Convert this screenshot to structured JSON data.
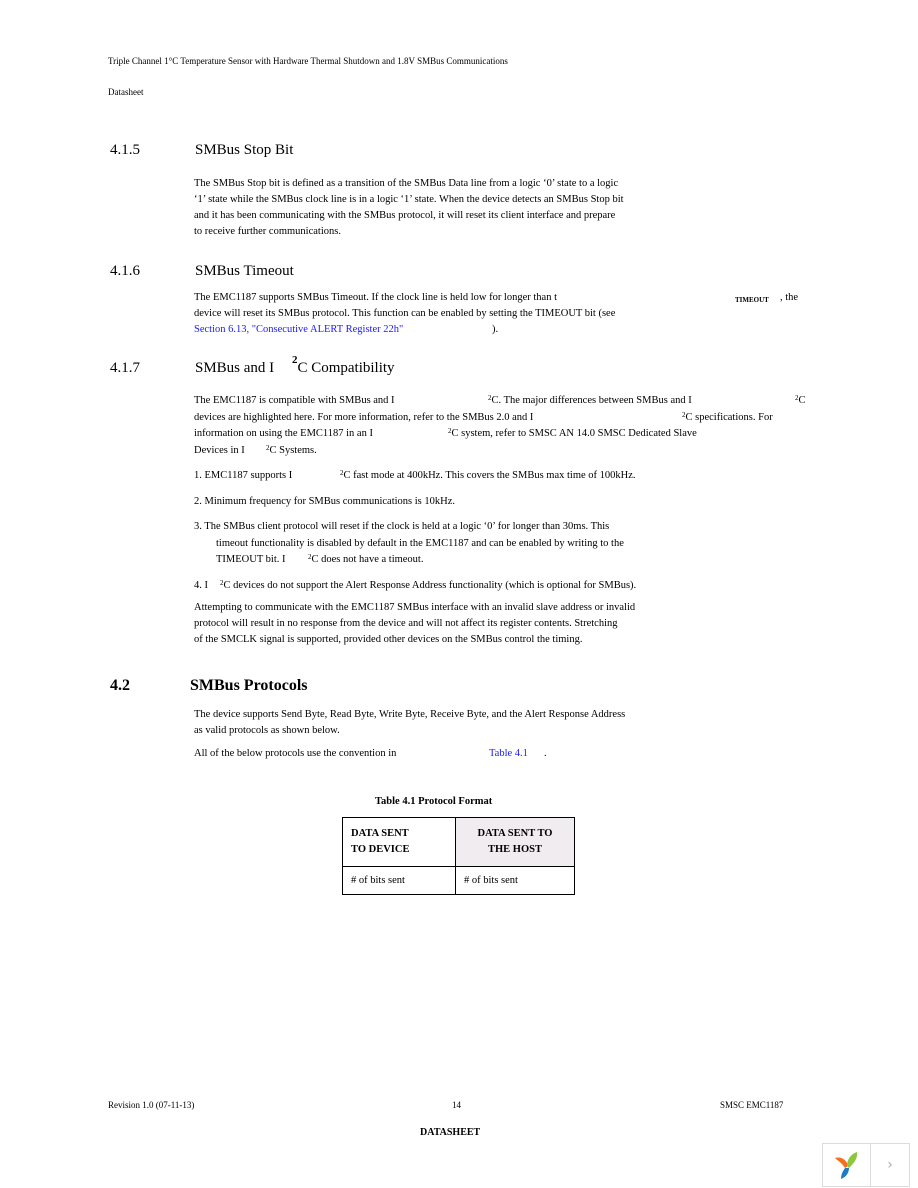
{
  "header": {
    "title": "Triple Channel 1°C Temperature Sensor with Hardware Thermal Shutdown and 1.8V SMBus Communications",
    "subtitle": "Datasheet"
  },
  "s415": {
    "num": "4.1.5",
    "title": "SMBus Stop Bit",
    "lines": [
      "The SMBus Stop bit is defined as a transition of the SMBus Data line from a logic ‘0’ state to a logic",
      "‘1’ state while the SMBus clock line is in a logic ‘1’ state. When the device detects an SMBus Stop bit",
      "and it has been communicating with the SMBus protocol, it will reset its client interface and prepare",
      "to receive further communications."
    ]
  },
  "s416": {
    "num": "4.1.6",
    "title": "SMBus Timeout",
    "line1": "The EMC1187 supports SMBus Timeout. If the clock line is held low for longer than t",
    "line1_sub": "TIMEOUT",
    "line1_end": ", the",
    "line2": "device will reset its SMBus protocol. This function can be enabled by setting the TIMEOUT bit (see",
    "link": "Section 6.13, \"Consecutive ALERT Register 22h\"",
    "line3_end": ")."
  },
  "s417": {
    "num": "4.1.7",
    "title_a": "SMBus and I",
    "title_sup": "2",
    "title_b": "C Compatibility",
    "p1": {
      "l1a": "The EMC1187 is compatible with SMBus and I",
      "l1b": "C. The major differences between SMBus and I",
      "l1c": "C",
      "l2a": "devices are highlighted here. For more information, refer to the SMBus 2.0 and I",
      "l2b": "C specifications. For",
      "l3a": "information on using the EMC1187 in an I",
      "l3b": "C system, refer to SMSC AN 14.0 SMSC Dedicated Slave",
      "l4a": "Devices in I",
      "l4b": "C Systems."
    },
    "sup": "2",
    "items": {
      "i1a": "1. EMC1187 supports I",
      "i1b": "C fast mode at 400kHz. This covers the SMBus max time of 100kHz.",
      "i2": "2. Minimum frequency for SMBus communications is 10kHz.",
      "i3a": "3. The SMBus client protocol will reset if the clock is held at a logic ‘0’ for longer than 30ms. This",
      "i3b": "timeout functionality is disabled by default in the EMC1187 and can be enabled by writing to the",
      "i3c": "TIMEOUT bit. I",
      "i3d": "C does not have a timeout.",
      "i4a": "4. I",
      "i4b": "C devices do not support the Alert Response Address functionality (which is optional for SMBus)."
    },
    "p2": [
      "Attempting to communicate with the EMC1187 SMBus interface with an invalid slave address or invalid",
      "protocol will result in no response from the device and will not affect its register contents. Stretching",
      "of the SMCLK signal is supported, provided other devices on the SMBus control the timing."
    ]
  },
  "s42": {
    "num": "4.2",
    "title": "SMBus Protocols",
    "p1": [
      "The device supports Send Byte, Read Byte, Write Byte, Receive Byte, and the Alert Response Address",
      "as valid protocols as shown below."
    ],
    "p2a": "All of the below protocols use the convention in",
    "p2link": "Table 4.1",
    "p2end": "."
  },
  "table": {
    "caption": "Table 4.1  Protocol Format",
    "head": [
      "DATA SENT TO DEVICE",
      "DATA SENT TO THE HOST"
    ],
    "head_lines": [
      [
        "DATA SENT",
        "TO DEVICE"
      ],
      [
        "DATA SENT TO",
        "THE HOST"
      ]
    ],
    "rows": [
      [
        "# of bits sent",
        "# of bits sent"
      ]
    ]
  },
  "footer": {
    "revision": "Revision 1.0 (07-11-13)",
    "page": "14",
    "company": "SMSC EMC1187",
    "label": "DATASHEET"
  },
  "nav": {
    "logo_icon": "yii-logo-icon",
    "next": "›"
  }
}
